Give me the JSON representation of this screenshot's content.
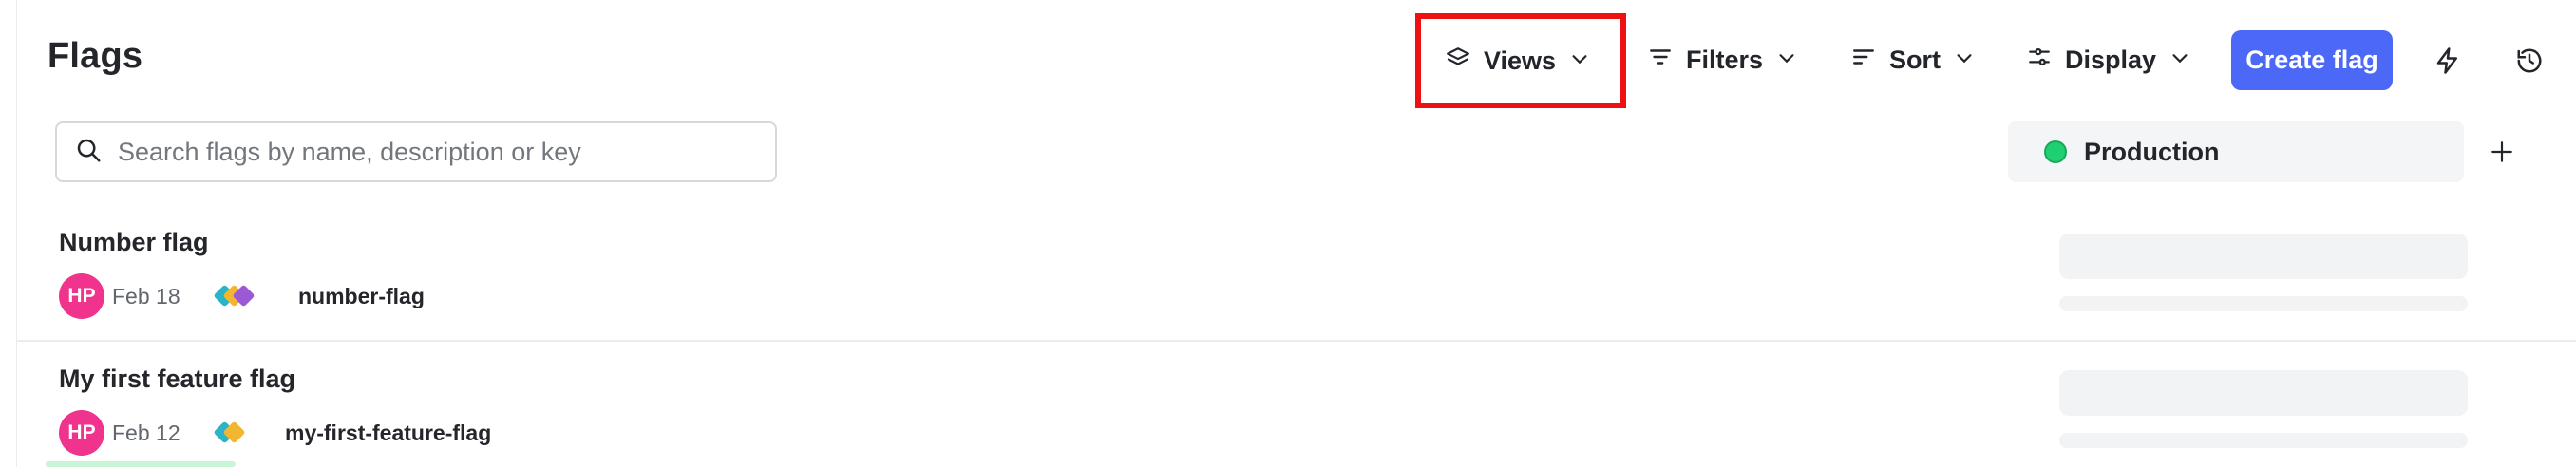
{
  "header": {
    "title": "Flags",
    "toolbar": {
      "views_label": "Views",
      "filters_label": "Filters",
      "sort_label": "Sort",
      "display_label": "Display",
      "create_label": "Create flag"
    }
  },
  "search": {
    "placeholder": "Search flags by name, description or key",
    "value": ""
  },
  "environment": {
    "name": "Production",
    "status_color": "#20cf72"
  },
  "flags": [
    {
      "name": "Number flag",
      "avatar_initials": "HP",
      "date": "Feb 18",
      "key": "number-flag",
      "variation_colors": [
        "#2bb3c7",
        "#f2b630",
        "#9b59d6"
      ]
    },
    {
      "name": "My first feature flag",
      "avatar_initials": "HP",
      "date": "Feb 12",
      "key": "my-first-feature-flag",
      "variation_colors": [
        "#2bb3c7",
        "#f2b630"
      ]
    }
  ],
  "colors": {
    "accent": "#4b69f6",
    "avatar": "#f0338d",
    "highlight_border": "#ee1111"
  },
  "icons": {
    "views": "layers-icon",
    "filters": "filter-lines-icon",
    "sort": "sort-lines-icon",
    "display": "sliders-icon",
    "bolt": "lightning-icon",
    "history": "history-icon",
    "search": "search-icon",
    "add": "plus-icon"
  }
}
